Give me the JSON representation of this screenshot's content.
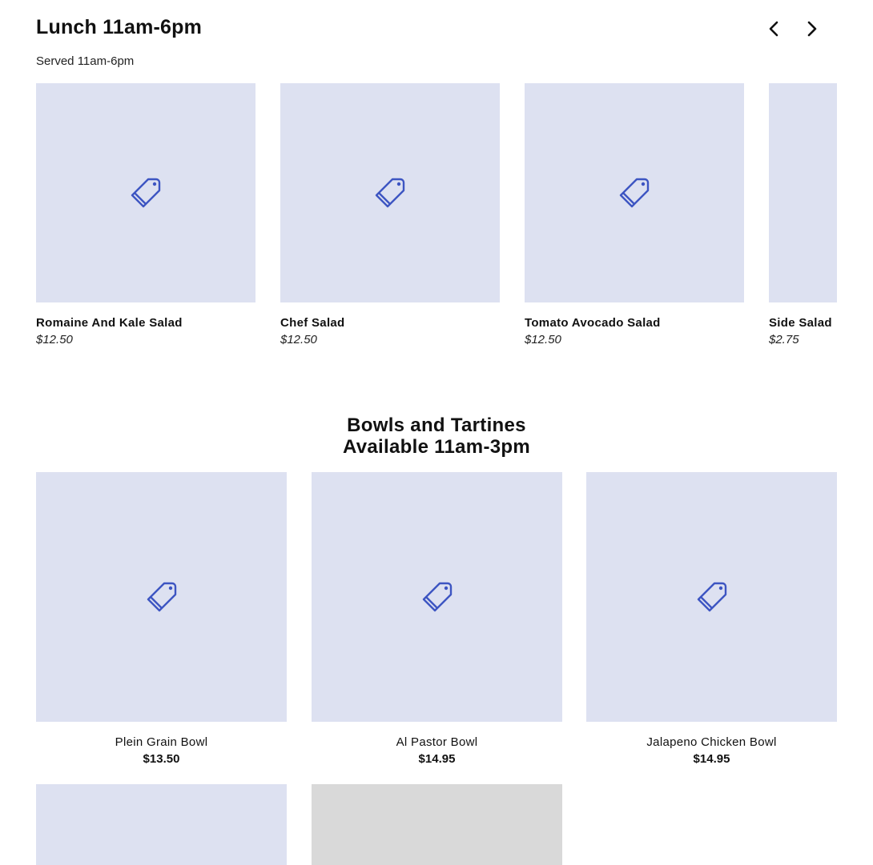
{
  "lunch": {
    "title": "Lunch 11am-6pm",
    "subtitle": "Served 11am-6pm",
    "prev_icon": "chevron-left-icon",
    "next_icon": "chevron-right-icon",
    "items": [
      {
        "name": "Romaine And Kale Salad",
        "price": "$12.50"
      },
      {
        "name": "Chef Salad",
        "price": "$12.50"
      },
      {
        "name": "Tomato Avocado Salad",
        "price": "$12.50"
      },
      {
        "name": "Side Salad",
        "price": "$2.75"
      }
    ]
  },
  "bowls": {
    "title_line1": "Bowls and Tartines",
    "title_line2": "Available 11am-3pm",
    "items": [
      {
        "name": "Plein Grain Bowl",
        "price": "$13.50"
      },
      {
        "name": "Al Pastor Bowl",
        "price": "$14.95"
      },
      {
        "name": "Jalapeno Chicken Bowl",
        "price": "$14.95"
      }
    ]
  },
  "colors": {
    "placeholder_bg": "#dde1f1",
    "icon_blue": "#3d55c2",
    "grey_placeholder": "#d9d9d9"
  },
  "icons": {
    "placeholder": "tag-icon"
  }
}
